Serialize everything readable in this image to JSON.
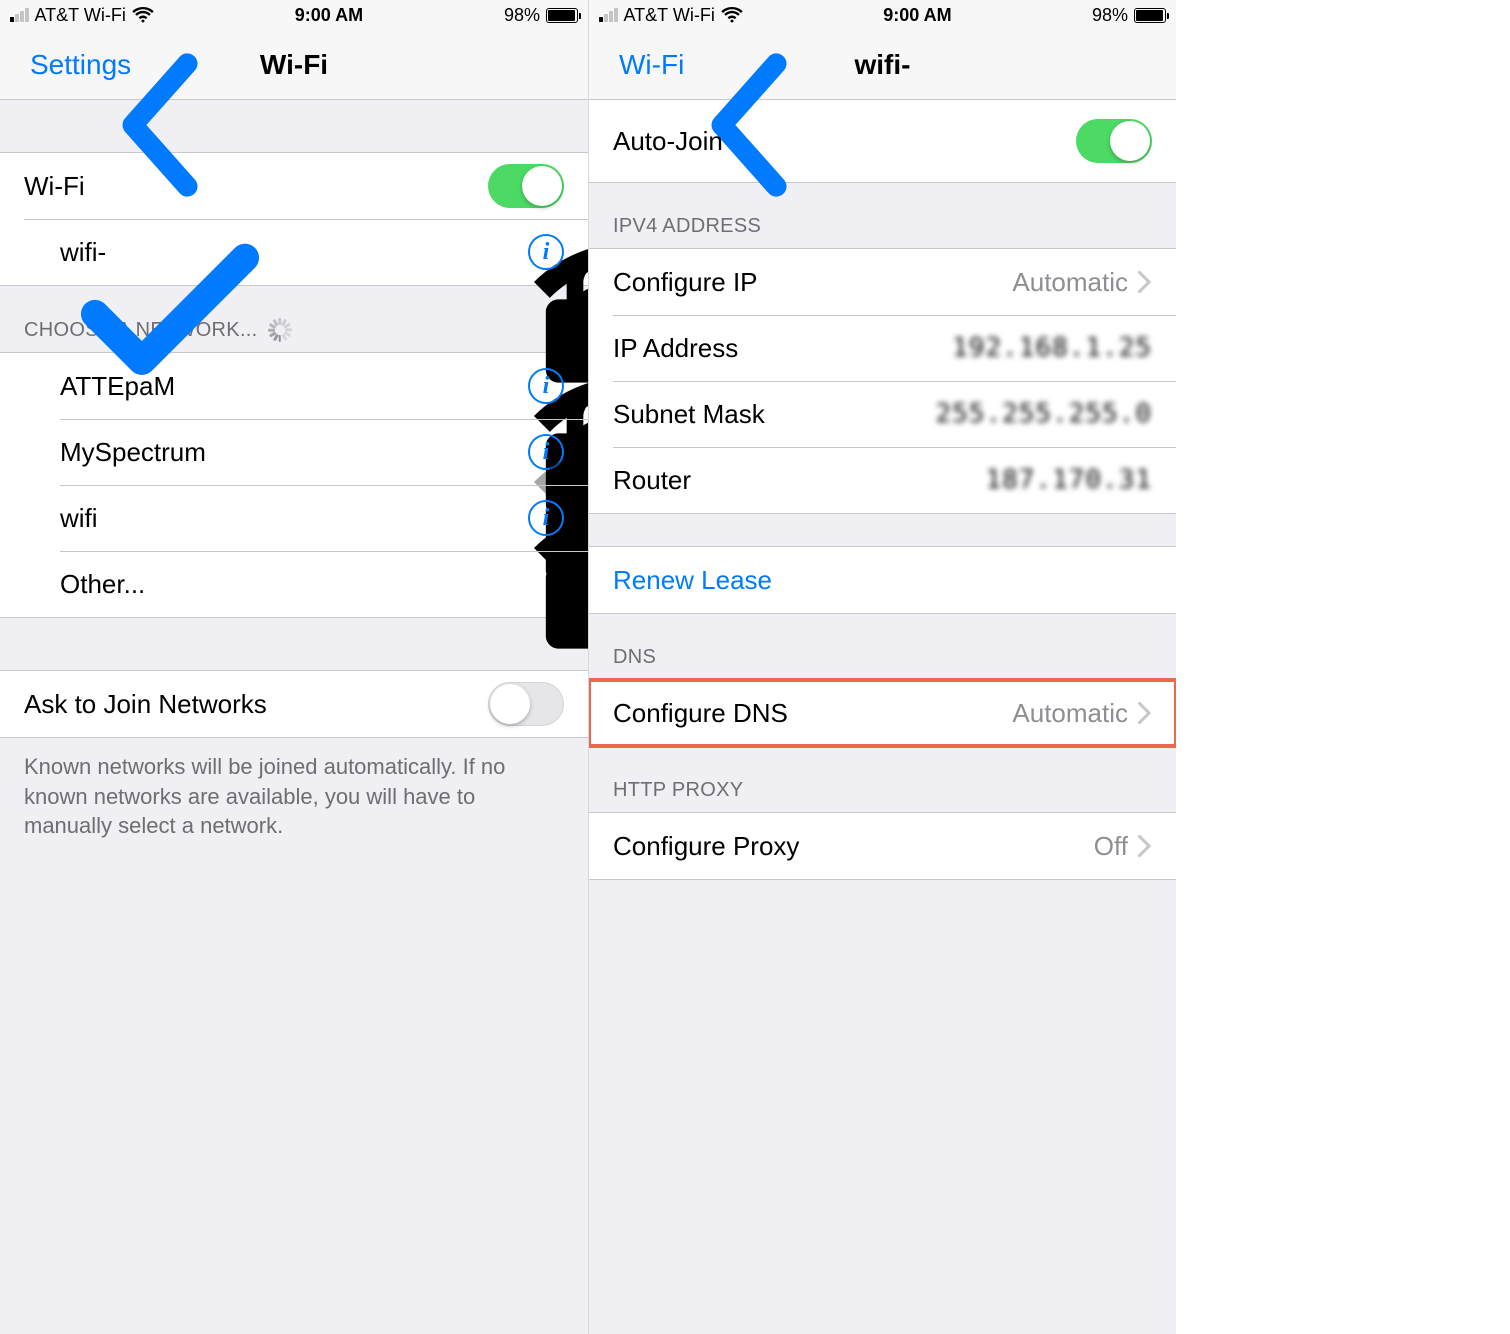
{
  "status": {
    "carrier": "AT&T Wi-Fi",
    "time": "9:00 AM",
    "battery_pct": "98%",
    "battery_fill": 98
  },
  "left": {
    "back_label": "Settings",
    "title": "Wi-Fi",
    "wifi_toggle_label": "Wi-Fi",
    "wifi_toggle_on": true,
    "connected_network": "wifi-",
    "choose_header": "CHOOSE A NETWORK...",
    "networks": [
      {
        "name": "ATTEpaM",
        "locked": true,
        "strength": "full"
      },
      {
        "name": "MySpectrum",
        "locked": true,
        "strength": "weak"
      },
      {
        "name": "wifi",
        "locked": true,
        "strength": "full"
      }
    ],
    "other_label": "Other...",
    "ask_label": "Ask to Join Networks",
    "ask_on": false,
    "footer": "Known networks will be joined automatically. If no known networks are available, you will have to manually select a network."
  },
  "right": {
    "back_label": "Wi-Fi",
    "title": "wifi-",
    "autojoin_label": "Auto-Join",
    "autojoin_on": true,
    "ipv4_header": "IPV4 ADDRESS",
    "configure_ip_label": "Configure IP",
    "configure_ip_value": "Automatic",
    "ip_address_label": "IP Address",
    "ip_address_value": "192.168.1.25",
    "subnet_label": "Subnet Mask",
    "subnet_value": "255.255.255.0",
    "router_label": "Router",
    "router_value": "187.170.31",
    "renew_label": "Renew Lease",
    "dns_header": "DNS",
    "configure_dns_label": "Configure DNS",
    "configure_dns_value": "Automatic",
    "proxy_header": "HTTP PROXY",
    "configure_proxy_label": "Configure Proxy",
    "configure_proxy_value": "Off"
  }
}
